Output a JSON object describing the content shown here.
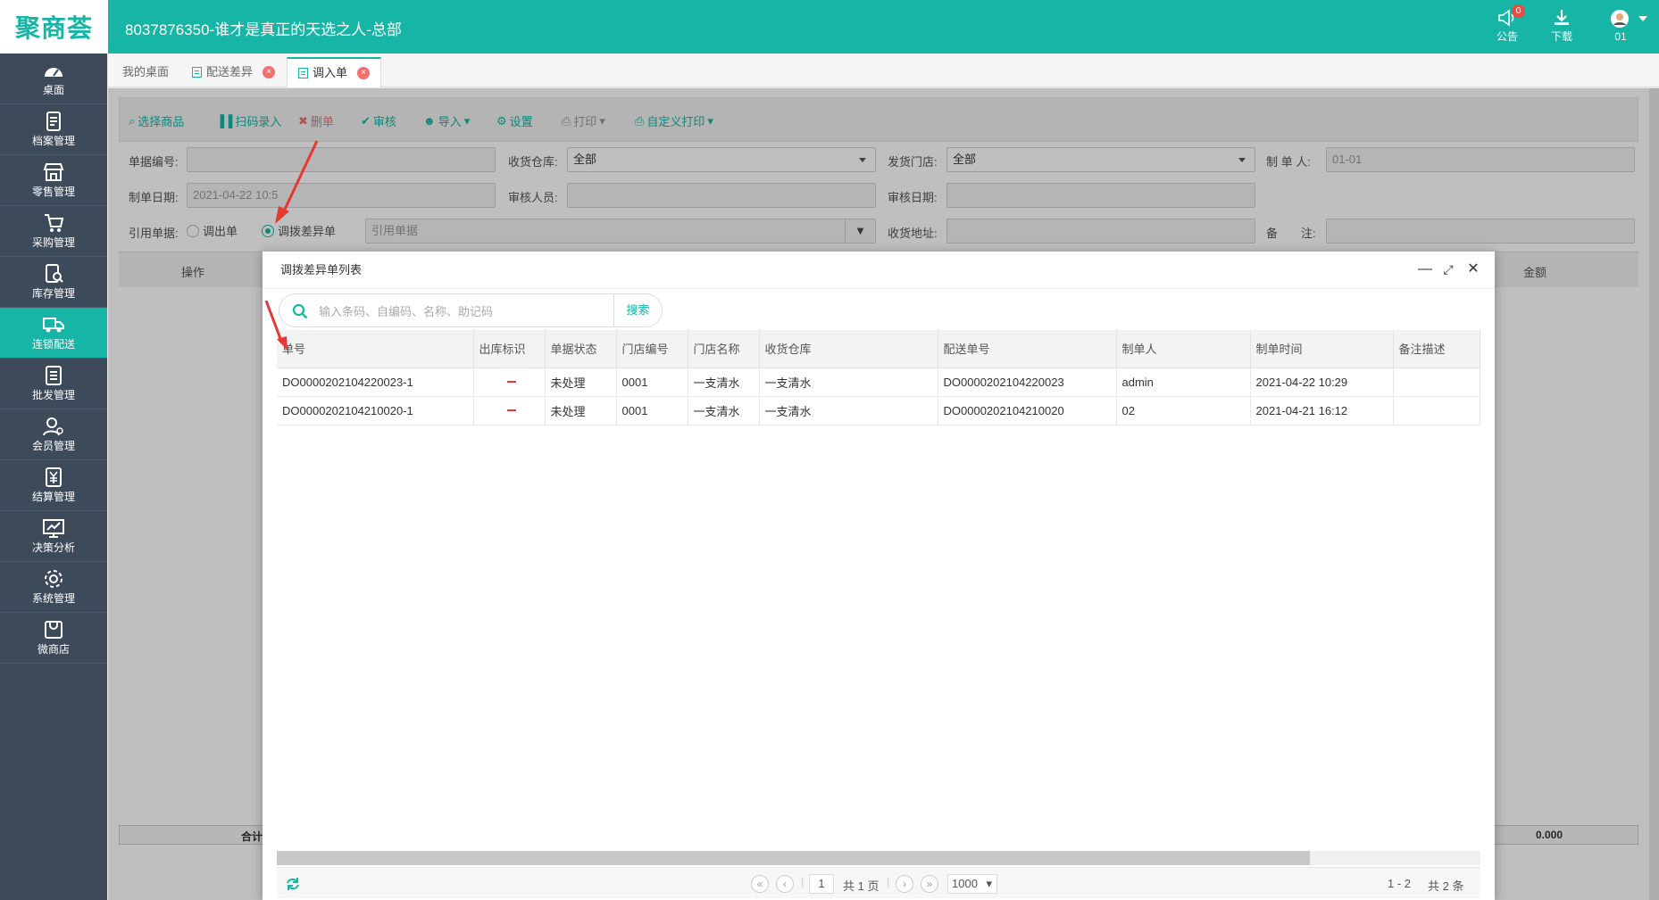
{
  "header": {
    "logo": "聚商荟",
    "title": "8037876350-谁才是真正的天选之人-总部",
    "notice_label": "公告",
    "notice_count": "0",
    "download_label": "下载",
    "user_label": "01"
  },
  "sidebar": {
    "items": [
      {
        "label": "桌面"
      },
      {
        "label": "档案管理"
      },
      {
        "label": "零售管理"
      },
      {
        "label": "采购管理"
      },
      {
        "label": "库存管理"
      },
      {
        "label": "连锁配送"
      },
      {
        "label": "批发管理"
      },
      {
        "label": "会员管理"
      },
      {
        "label": "结算管理"
      },
      {
        "label": "决策分析"
      },
      {
        "label": "系统管理"
      },
      {
        "label": "微商店"
      }
    ]
  },
  "tabs": [
    {
      "label": "我的桌面"
    },
    {
      "label": "配送差异"
    },
    {
      "label": "调入单"
    }
  ],
  "toolbar": {
    "select_goods": "选择商品",
    "scan_entry": "扫码录入",
    "delete": "删单",
    "audit": "审核",
    "import": "导入",
    "settings": "设置",
    "print": "打印",
    "custom_print": "自定义打印"
  },
  "form": {
    "doc_no_label": "单据编号:",
    "receive_wh_label": "收货仓库:",
    "receive_wh_value": "全部",
    "ship_store_label": "发货门店:",
    "ship_store_value": "全部",
    "maker_label": "制 单 人:",
    "maker_value": "01-01",
    "date_label": "制单日期:",
    "date_value": "2021-04-22 10:5",
    "auditor_label": "审核人员:",
    "audit_date_label": "审核日期:",
    "ref_label": "引用单据:",
    "ref_opt1": "调出单",
    "ref_opt2": "调拨差异单",
    "ref_placeholder": "引用单据",
    "address_label": "收货地址:",
    "remark_label": "备　　注:"
  },
  "grid": {
    "op_header": "操作",
    "amount_header": "金额",
    "total_label": "合计",
    "total_value": "0.000"
  },
  "modal": {
    "title": "调拨差异单列表",
    "search_placeholder": "输入条码、自编码、名称、助记码",
    "search_button": "搜索",
    "columns": [
      "单号",
      "出库标识",
      "单据状态",
      "门店编号",
      "门店名称",
      "收货仓库",
      "配送单号",
      "制单人",
      "制单时间",
      "备注描述"
    ],
    "rows": [
      {
        "no": "DO0000202104220023-1",
        "status": "未处理",
        "store_no": "0001",
        "store_name": "一支清水",
        "warehouse": "一支清水",
        "delivery_no": "DO0000202104220023",
        "maker": "admin",
        "time": "2021-04-22 10:29",
        "remark": ""
      },
      {
        "no": "DO0000202104210020-1",
        "status": "未处理",
        "store_no": "0001",
        "store_name": "一支清水",
        "warehouse": "一支清水",
        "delivery_no": "DO0000202104210020",
        "maker": "02",
        "time": "2021-04-21 16:12",
        "remark": ""
      }
    ],
    "pager": {
      "page": "1",
      "total_pages": "共 1 页",
      "page_size": "1000",
      "range": "1 - 2",
      "total": "共 2 条"
    }
  },
  "colors": {
    "accent": "#16b5a6",
    "sidebar": "#3d4a5a",
    "status_link": "#1a3fd8",
    "arrow": "#e53935"
  }
}
